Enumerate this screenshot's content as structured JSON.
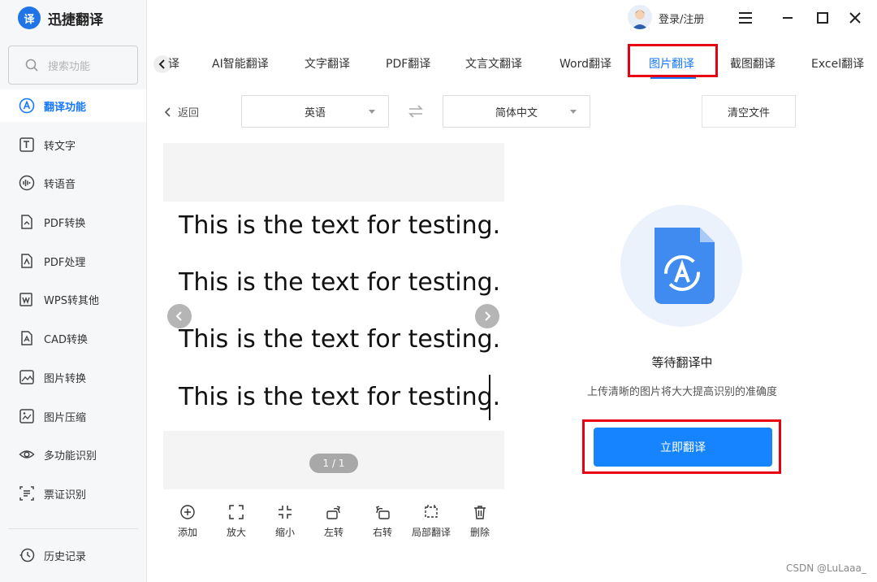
{
  "app": {
    "title": "迅捷翻译",
    "logo_glyph": "译"
  },
  "search": {
    "placeholder": "搜索功能"
  },
  "sidebar": {
    "items": [
      {
        "label": "翻译功能",
        "icon": "translate-icon",
        "active": true
      },
      {
        "label": "转文字",
        "icon": "text-icon"
      },
      {
        "label": "转语音",
        "icon": "audio-icon"
      },
      {
        "label": "PDF转换",
        "icon": "pdf-convert-icon"
      },
      {
        "label": "PDF处理",
        "icon": "pdf-process-icon"
      },
      {
        "label": "WPS转其他",
        "icon": "wps-icon"
      },
      {
        "label": "CAD转换",
        "icon": "cad-icon"
      },
      {
        "label": "图片转换",
        "icon": "image-convert-icon"
      },
      {
        "label": "图片压缩",
        "icon": "image-compress-icon"
      },
      {
        "label": "多功能识别",
        "icon": "eye-icon"
      },
      {
        "label": "票证识别",
        "icon": "ticket-icon"
      }
    ],
    "history": "历史记录"
  },
  "header": {
    "login": "登录/注册"
  },
  "tabs": {
    "items": [
      "译",
      "AI智能翻译",
      "文字翻译",
      "PDF翻译",
      "文言文翻译",
      "Word翻译",
      "图片翻译",
      "截图翻译",
      "Excel翻译"
    ],
    "active_index": 6
  },
  "toolbar": {
    "back": "返回",
    "source_lang": "英语",
    "target_lang": "简体中文",
    "clear": "清空文件"
  },
  "preview": {
    "lines": [
      "This is the text for testing.",
      "This is the text for testing.",
      "This is the text for testing.",
      "This is the text for testing."
    ],
    "page_indicator": "1 / 1"
  },
  "tools": [
    "添加",
    "放大",
    "缩小",
    "左转",
    "右转",
    "局部翻译",
    "删除"
  ],
  "result": {
    "status": "等待翻译中",
    "tip": "上传清晰的图片将大大提高识别的准确度",
    "button": "立即翻译"
  },
  "watermark": "CSDN @LuLaaa_",
  "colors": {
    "accent": "#1677ff",
    "highlight_box": "#e60012",
    "button": "#1683ff"
  }
}
